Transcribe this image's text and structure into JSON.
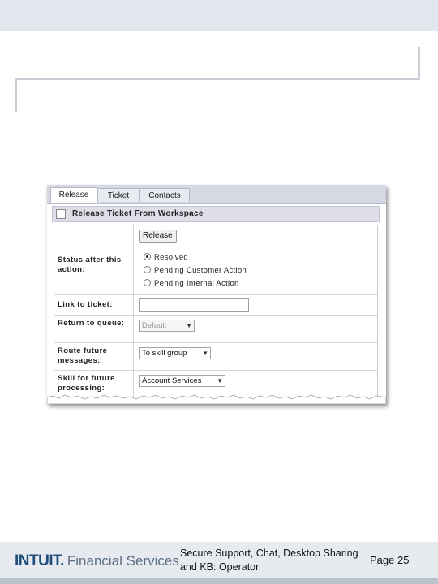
{
  "tabs": [
    {
      "label": "Release",
      "active": true
    },
    {
      "label": "Ticket",
      "active": false
    },
    {
      "label": "Contacts",
      "active": false
    }
  ],
  "panel": {
    "title": "Release Ticket From Workspace"
  },
  "form": {
    "release_button": "Release",
    "status_label": "Status after this action:",
    "status_options": [
      {
        "label": "Resolved",
        "selected": true
      },
      {
        "label": "Pending Customer Action",
        "selected": false
      },
      {
        "label": "Pending Internal Action",
        "selected": false
      }
    ],
    "link_label": "Link to ticket:",
    "link_value": "",
    "queue_label": "Return to queue:",
    "queue_value": "Default",
    "route_label": "Route future messages:",
    "route_value": "To skill group",
    "skill_label": "Skill for future processing:",
    "skill_value": "Account Services"
  },
  "footer": {
    "brand": "INTUIT.",
    "brand_tagline": "Financial Services",
    "title": "Secure Support, Chat, Desktop Sharing and KB: Operator",
    "page": "Page 25"
  },
  "colors": {
    "brand_blue": "#1f4e79",
    "panel_header": "#dedfe9"
  }
}
